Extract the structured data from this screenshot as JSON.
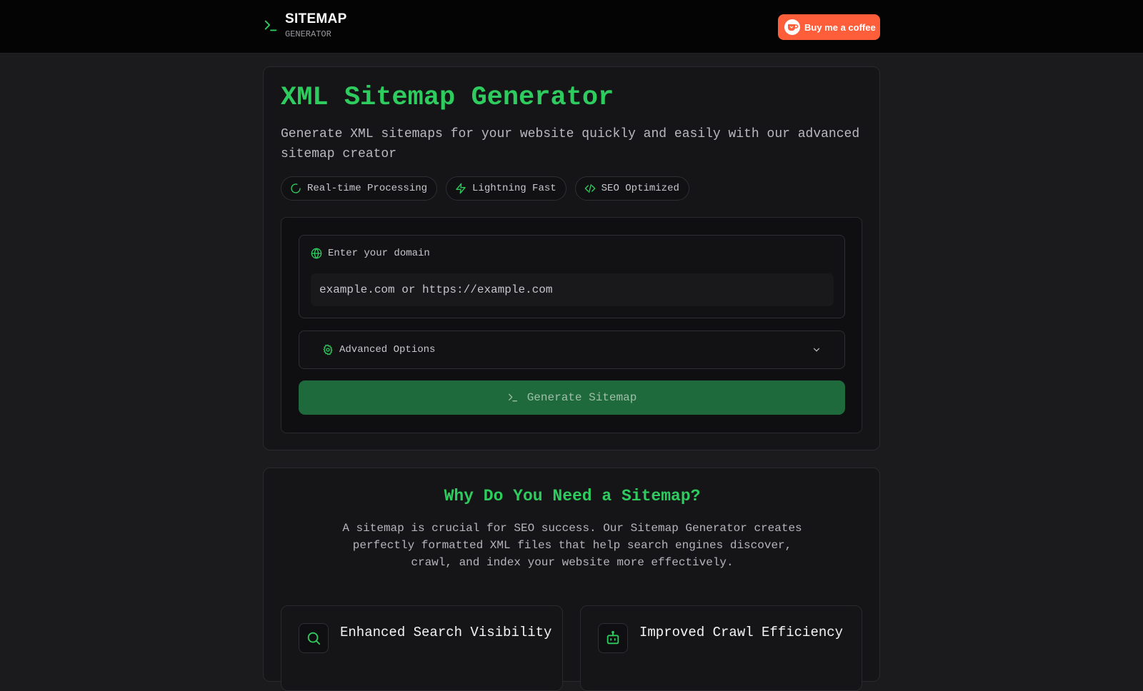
{
  "header": {
    "title": "SITEMAP",
    "subtitle": "GENERATOR",
    "coffee_label": "Buy me a coffee"
  },
  "hero": {
    "title": "XML Sitemap Generator",
    "description": "Generate XML sitemaps for your website quickly and easily with our advanced sitemap creator",
    "pills": [
      {
        "icon": "spinner-icon",
        "label": "Real-time Processing"
      },
      {
        "icon": "lightning-icon",
        "label": "Lightning Fast"
      },
      {
        "icon": "code-icon",
        "label": "SEO Optimized"
      }
    ]
  },
  "form": {
    "domain_label": "Enter your domain",
    "domain_placeholder": "example.com or https://example.com",
    "domain_value": "",
    "advanced_label": "Advanced Options",
    "generate_label": "Generate Sitemap"
  },
  "why": {
    "title": "Why Do You Need a Sitemap?",
    "description": "A sitemap is crucial for SEO success. Our Sitemap Generator creates perfectly formatted XML files that help search engines discover, crawl, and index your website more effectively.",
    "features": [
      {
        "icon": "search-icon",
        "title": "Enhanced Search Visibility"
      },
      {
        "icon": "robot-icon",
        "title": "Improved Crawl Efficiency"
      }
    ]
  },
  "colors": {
    "accent": "#2ecc5e",
    "button": "#1f6a3d",
    "coffee": "#ff5e3a",
    "background": "#1b1b1e"
  }
}
